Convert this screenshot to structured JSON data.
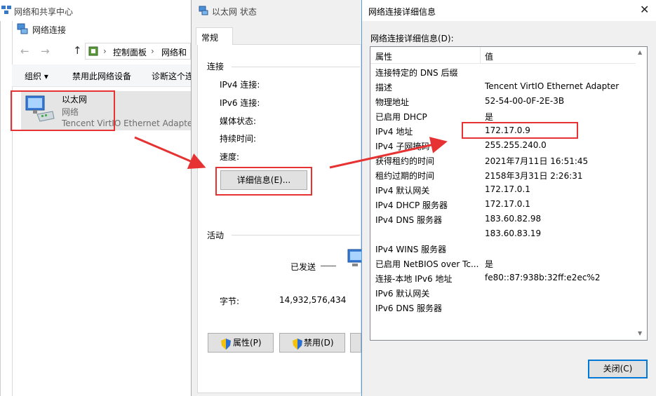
{
  "window1": {
    "title": "网络和共享中心",
    "subtitle": "网络连接",
    "breadcrumb": [
      "控制面板",
      "网络和"
    ],
    "commands": [
      "组织 ▾",
      "禁用此网络设备",
      "诊断这个连"
    ],
    "adapter": {
      "name": "以太网",
      "type": "网络",
      "device": "Tencent VirtIO Ethernet Adapter"
    }
  },
  "window2": {
    "title": "以太网 状态",
    "tab": "常规",
    "section_connection": "连接",
    "fields": [
      "IPv4 连接:",
      "IPv6 连接:",
      "媒体状态:",
      "持续时间:",
      "速度:"
    ],
    "details_button": "详细信息(E)...",
    "section_activity": "活动",
    "sent_label": "已发送",
    "bytes_label": "字节:",
    "bytes_value": "14,932,576,434",
    "properties_button": "属性(P)",
    "disable_button": "禁用(D)"
  },
  "window3": {
    "title": "网络连接详细信息",
    "list_label": "网络连接详细信息(D):",
    "col_property": "属性",
    "col_value": "值",
    "rows": [
      [
        "连接特定的 DNS 后缀",
        ""
      ],
      [
        "描述",
        "Tencent VirtIO Ethernet Adapter"
      ],
      [
        "物理地址",
        "52-54-00-0F-2E-3B"
      ],
      [
        "已启用 DHCP",
        "是"
      ],
      [
        "IPv4 地址",
        "172.17.0.9"
      ],
      [
        "IPv4 子网掩码",
        "255.255.240.0"
      ],
      [
        "获得租约的时间",
        "2021年7月11日 16:51:45"
      ],
      [
        "租约过期的时间",
        "2158年3月31日 2:26:31"
      ],
      [
        "IPv4 默认网关",
        "172.17.0.1"
      ],
      [
        "IPv4 DHCP 服务器",
        "172.17.0.1"
      ],
      [
        "IPv4 DNS 服务器",
        "183.60.82.98"
      ],
      [
        "",
        "183.60.83.19"
      ],
      [
        "IPv4 WINS 服务器",
        ""
      ],
      [
        "已启用 NetBIOS over Tc...",
        "是"
      ],
      [
        "连接-本地 IPv6 地址",
        "fe80::87:938b:32ff:e2ec%2"
      ],
      [
        "IPv6 默认网关",
        ""
      ],
      [
        "IPv6 DNS 服务器",
        ""
      ]
    ],
    "close_button": "关闭(C)"
  },
  "colors": {
    "highlight": "#e63232",
    "accent_border": "#5b9bd5",
    "button_focus": "#0078d7"
  }
}
